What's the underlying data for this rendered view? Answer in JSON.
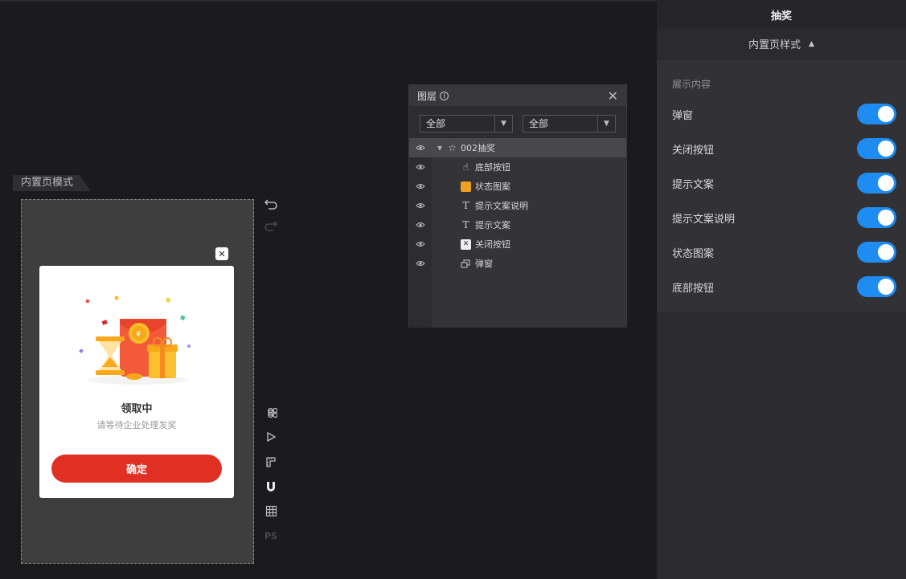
{
  "canvas": {
    "mode_label": "内置页模式",
    "popup": {
      "title": "领取中",
      "description": "请等待企业处理发奖",
      "confirm_label": "确定"
    }
  },
  "tools": [
    "undo-icon",
    "redo-icon",
    "command-icon",
    "play-icon",
    "ruler-icon",
    "magnet-icon",
    "grid-icon",
    "ps-icon"
  ],
  "tools_ps_text": "PS",
  "layers_panel": {
    "title": "图层",
    "filter1": "全部",
    "filter2": "全部",
    "rows": [
      {
        "label": "002抽奖",
        "icon": "component-icon"
      },
      {
        "label": "底部按钮",
        "icon": "hand-icon"
      },
      {
        "label": "状态图案",
        "icon": "image-icon"
      },
      {
        "label": "提示文案说明",
        "icon": "text-icon"
      },
      {
        "label": "提示文案",
        "icon": "text-icon"
      },
      {
        "label": "关闭按钮",
        "icon": "close-image-icon"
      },
      {
        "label": "弹窗",
        "icon": "window-icon"
      }
    ]
  },
  "right_panel": {
    "title": "抽奖",
    "subtitle": "内置页样式",
    "section_label": "展示内容",
    "toggles": [
      {
        "label": "弹窗",
        "on": true
      },
      {
        "label": "关闭按钮",
        "on": true
      },
      {
        "label": "提示文案",
        "on": true
      },
      {
        "label": "提示文案说明",
        "on": true
      },
      {
        "label": "状态图案",
        "on": true
      },
      {
        "label": "底部按钮",
        "on": true
      }
    ]
  },
  "colors": {
    "toggle_on": "#1e8cf0",
    "confirm_button": "#e03024"
  }
}
